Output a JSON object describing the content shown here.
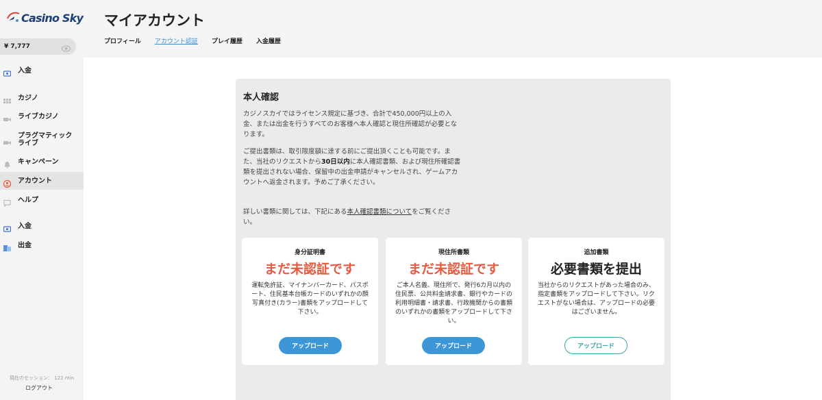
{
  "brand": {
    "name": "Casino Sky"
  },
  "balance": {
    "value": "¥ 7,777"
  },
  "sidebar": {
    "items": [
      {
        "label": "入金",
        "icon": "deposit-icon"
      },
      {
        "label": "カジノ",
        "icon": "grid-icon"
      },
      {
        "label": "ライブカジノ",
        "icon": "video-icon"
      },
      {
        "label": "プラグマティック ライブ",
        "icon": "video-icon"
      },
      {
        "label": "キャンペーン",
        "icon": "bell-icon"
      },
      {
        "label": "アカウント",
        "icon": "account-icon"
      },
      {
        "label": "ヘルプ",
        "icon": "chat-icon"
      },
      {
        "label": "入金",
        "icon": "deposit-icon"
      },
      {
        "label": "出金",
        "icon": "withdraw-icon"
      }
    ],
    "session": "現在のセッション： 122 min",
    "logout": "ログアウト"
  },
  "header": {
    "title": "マイアカウント",
    "tabs": [
      "プロフィール",
      "アカウント認証",
      "プレイ履歴",
      "入金履歴"
    ]
  },
  "verify": {
    "title": "本人確認",
    "p1": "カジノスカイではライセンス規定に基づき、合計で450,000円以上の入金、または出金を行うすべてのお客様へ本人確認と現住所確認が必要となります。",
    "p2_a": "ご提出書類は、取引限度額に達する前にご提出頂くことも可能です。また、当社のリクエストから",
    "p2_bold": "30日以内",
    "p2_b": "に本人確認書類、および現住所確認書類を提出されない場合、保留中の出金申請がキャンセルされ、ゲームアカウントへ返金されます。予めご了承ください。",
    "p3_a": "詳しい書類に関しては、下記にある",
    "p3_link": "本人確認書類について",
    "p3_b": "をご覧ください。"
  },
  "cards": [
    {
      "label": "身分証明書",
      "status": "まだ未認証です",
      "desc": "運転免許証、マイナンバーカード、パスポート、住民基本台帳カードのいずれかの顔写真付き(カラー)書類をアップロードして下さい。",
      "button": "アップロード"
    },
    {
      "label": "現住所書類",
      "status": "まだ未認証です",
      "desc": "ご本人名義、現住所で、発行6カ月以内の住民票、公共料金請求書、銀行やカードの利用明細書・請求書、行政機関からの書類のいずれかの書類をアップロードして下さい。",
      "button": "アップロード"
    },
    {
      "label": "追加書類",
      "status": "必要書類を提出",
      "desc": "当社からのリクエストがあった場合のみ、指定書類をアップロードして下さい。リクエストがない場合は、アップロードの必要はございません。",
      "button": "アップロード"
    }
  ],
  "colors": {
    "accent_blue": "#3d96d6",
    "status_red": "#e85a3f",
    "outline_teal": "#3aa3a8",
    "brand_navy": "#1f3f7a"
  }
}
